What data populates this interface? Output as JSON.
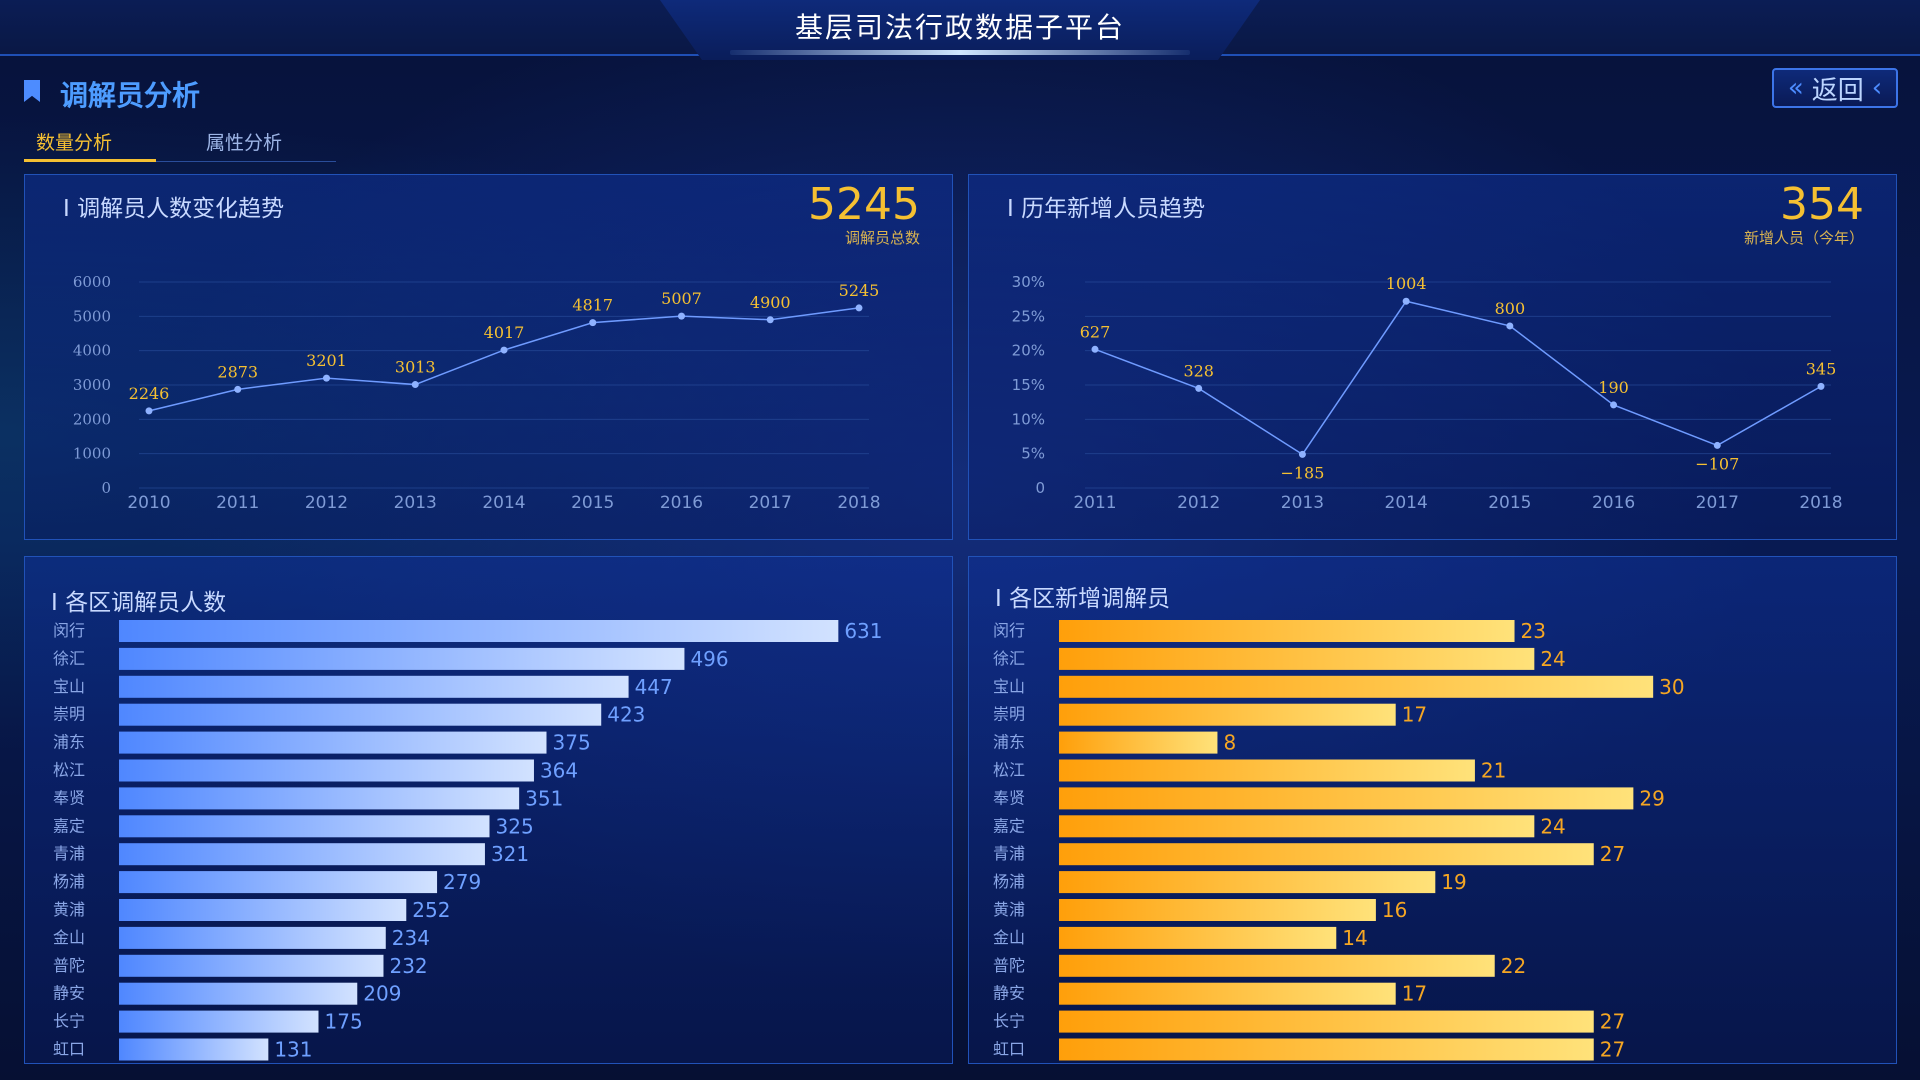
{
  "header": {
    "title": "基层司法行政数据子平台"
  },
  "section": {
    "title": "调解员分析",
    "back_label": "返回"
  },
  "tabs": [
    {
      "label": "数量分析",
      "active": true
    },
    {
      "label": "属性分析",
      "active": false
    }
  ],
  "colors": {
    "accent": "#f5c032",
    "blue_bar_start": "#4f87ff",
    "blue_bar_end": "#d2e2ff",
    "orange_bar_start": "#ff9f0a",
    "orange_bar_end": "#ffe27a",
    "line": "#6f9bff"
  },
  "chart_data": [
    {
      "type": "line",
      "title": "调解员人数变化趋势",
      "summary_value": "5245",
      "summary_label": "调解员总数",
      "x": [
        "2010",
        "2011",
        "2012",
        "2013",
        "2014",
        "2015",
        "2016",
        "2017",
        "2018"
      ],
      "values": [
        2246,
        2873,
        3201,
        3013,
        4017,
        4817,
        5007,
        4900,
        5245
      ],
      "yticks": [
        "0",
        "1000",
        "2000",
        "3000",
        "4000",
        "5000",
        "6000"
      ],
      "ylim": [
        0,
        6000
      ],
      "grid": true
    },
    {
      "type": "line",
      "title": "历年新增人员趋势",
      "summary_value": "354",
      "summary_label": "新增人员（今年）",
      "x": [
        "2011",
        "2012",
        "2013",
        "2014",
        "2015",
        "2016",
        "2017",
        "2018"
      ],
      "values": [
        20.2,
        14.5,
        4.9,
        27.2,
        23.6,
        12.1,
        6.2,
        14.8
      ],
      "labels": [
        "627",
        "328",
        "-185",
        "1004",
        "800",
        "190",
        "-107",
        "345"
      ],
      "yticks": [
        "0",
        "5%",
        "10%",
        "15%",
        "20%",
        "25%",
        "30%"
      ],
      "ylim": [
        0,
        30
      ],
      "grid": true
    },
    {
      "type": "bar",
      "orientation": "horizontal",
      "title": "各区调解员人数",
      "categories": [
        "闵行",
        "徐汇",
        "宝山",
        "崇明",
        "浦东",
        "松江",
        "奉贤",
        "嘉定",
        "青浦",
        "杨浦",
        "黄浦",
        "金山",
        "普陀",
        "静安",
        "长宁",
        "虹口"
      ],
      "values": [
        631,
        496,
        447,
        423,
        375,
        364,
        351,
        325,
        321,
        279,
        252,
        234,
        232,
        209,
        175,
        131
      ],
      "xlim": [
        0,
        800
      ]
    },
    {
      "type": "bar",
      "orientation": "horizontal",
      "title": "各区新增调解员",
      "categories": [
        "闵行",
        "徐汇",
        "宝山",
        "崇明",
        "浦东",
        "松江",
        "奉贤",
        "嘉定",
        "青浦",
        "杨浦",
        "黄浦",
        "金山",
        "普陀",
        "静安",
        "长宁",
        "虹口"
      ],
      "values": [
        23,
        24,
        30,
        17,
        8,
        21,
        29,
        24,
        27,
        19,
        16,
        14,
        22,
        17,
        27,
        27
      ],
      "xlim": [
        0,
        36
      ]
    }
  ]
}
